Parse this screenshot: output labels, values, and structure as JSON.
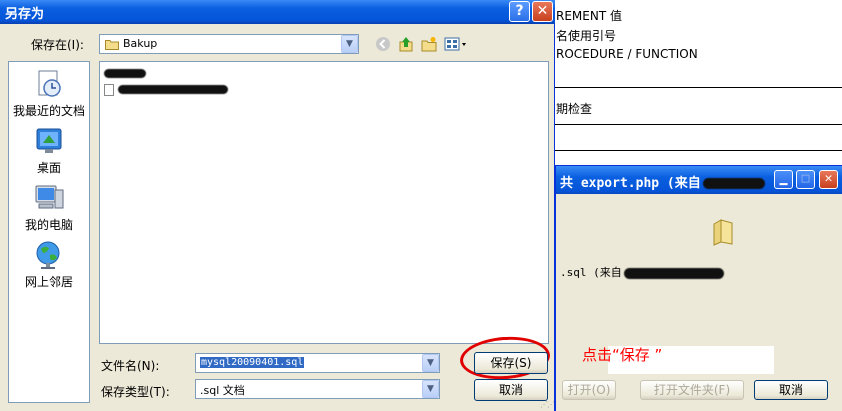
{
  "background_page": {
    "lines": [
      "REMENT 值",
      "名使用引号",
      "ROCEDURE / FUNCTION",
      "期检查"
    ]
  },
  "download_dialog": {
    "title": "共 export.php (来自",
    "file_text": ".sql (来自",
    "annotation": "点击“保存 ”",
    "open_button": "打开(O)",
    "open_folder_button": "打开文件夹(F)",
    "cancel_button": "取消"
  },
  "save_dialog": {
    "title": "另存为",
    "help_glyph": "?",
    "close_glyph": "✕",
    "save_in_label": "保存在(I):",
    "save_in_value": "Bakup",
    "places": [
      "我最近的文档",
      "桌面",
      "我的电脑",
      "网上邻居"
    ],
    "filename_label": "文件名(N):",
    "filename_value": "mysql20090401.sql",
    "filetype_label": "保存类型(T):",
    "filetype_value": ".sql 文档",
    "save_button": "保存(S)",
    "cancel_button": "取消"
  },
  "colors": {
    "titlebar": "#0554d8",
    "dialog_bg": "#ece9d8",
    "annotation": "#ff0000"
  }
}
